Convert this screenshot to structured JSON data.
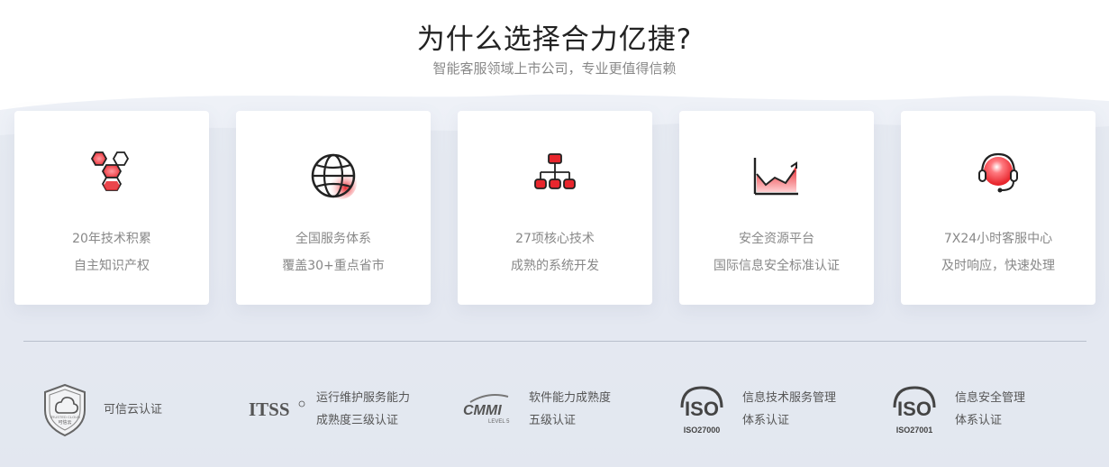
{
  "header": {
    "title": "为什么选择合力亿捷?",
    "subtitle": "智能客服领域上市公司，专业更值得信赖"
  },
  "features": [
    {
      "icon": "hexagon-cluster-icon",
      "line1": "20年技术积累",
      "line2": "自主知识产权"
    },
    {
      "icon": "globe-icon",
      "line1": "全国服务体系",
      "line2": "覆盖30+重点省市"
    },
    {
      "icon": "org-tree-icon",
      "line1": "27项核心技术",
      "line2": "成熟的系统开发"
    },
    {
      "icon": "area-chart-icon",
      "line1": "安全资源平台",
      "line2": "国际信息安全标准认证"
    },
    {
      "icon": "headset-icon",
      "line1": "7X24小时客服中心",
      "line2": "及时响应，快速处理"
    }
  ],
  "certifications": [
    {
      "logo": "trusted-cloud-shield-logo",
      "logo_text": "可信云",
      "logo_caption": "TRUSTED CLOUD",
      "line1": "可信云认证",
      "line2": ""
    },
    {
      "logo": "itss-logo",
      "logo_text": "ITSS",
      "line1": "运行维护服务能力",
      "line2": "成熟度三级认证"
    },
    {
      "logo": "cmmi-logo",
      "logo_text": "CMMI",
      "logo_sub": "LEVEL 5",
      "line1": "软件能力成熟度",
      "line2": "五级认证"
    },
    {
      "logo": "iso-logo",
      "logo_text": "ISO",
      "logo_sub": "ISO27000",
      "line1": "信息技术服务管理",
      "line2": "体系认证"
    },
    {
      "logo": "iso-logo",
      "logo_text": "ISO",
      "logo_sub": "ISO27001",
      "line1": "信息安全管理",
      "line2": "体系认证"
    }
  ],
  "colors": {
    "accent": "#e8262d",
    "background_band": "#e8ecf4",
    "text_muted": "#888888"
  }
}
